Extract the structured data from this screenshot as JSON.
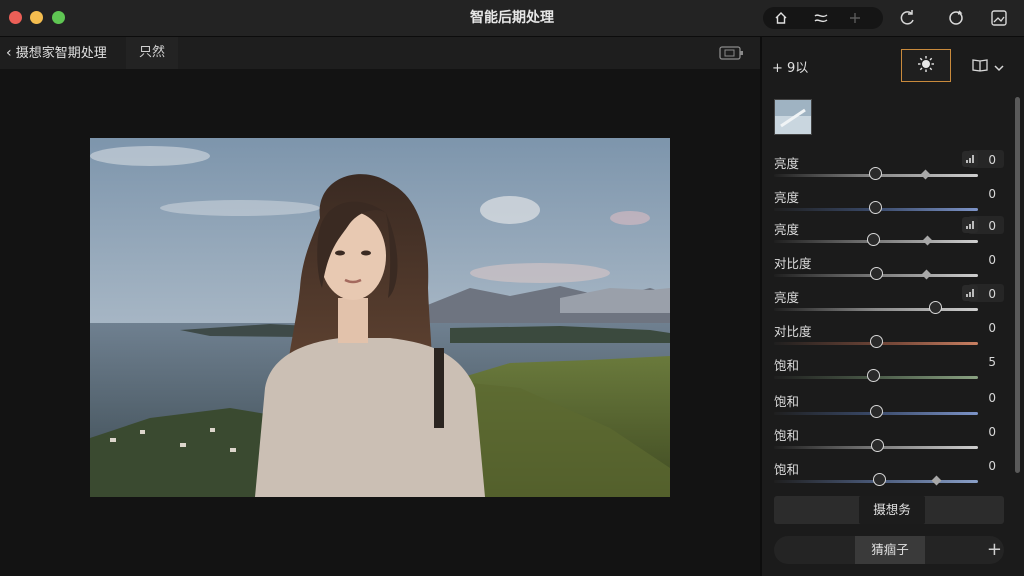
{
  "window": {
    "title": "智能后期处理",
    "icons": [
      "home-icon",
      "compare-icon",
      "sparkle-icon",
      "rotate-left-icon",
      "refresh-icon",
      "image-export-icon"
    ]
  },
  "toolbar": {
    "back_label": "摄想家智期处理",
    "tab_label": "只然"
  },
  "panel": {
    "add_label": "+ 9以",
    "adjustments": [
      {
        "label": "亮度",
        "value": "0",
        "chip": true
      },
      {
        "label": "亮度",
        "value": "0",
        "chip": false
      },
      {
        "label": "亮度",
        "value": "0",
        "chip": true
      },
      {
        "label": "对比度",
        "value": "0",
        "chip": false
      },
      {
        "label": "亮度",
        "value": "0",
        "chip": true
      },
      {
        "label": "对比度",
        "value": "0",
        "chip": false
      },
      {
        "label": "饱和",
        "value": "5",
        "chip": false
      },
      {
        "label": "饱和",
        "value": "0",
        "chip": false
      },
      {
        "label": "饱和",
        "value": "0",
        "chip": false
      },
      {
        "label": "饱和",
        "value": "0",
        "chip": false
      }
    ],
    "button1_label": "摄想务",
    "button2_label": "猜痼子"
  },
  "colors": {
    "accent": "#c98a3c",
    "panel_bg": "#1b1b1b",
    "titlebar_bg": "#232323"
  }
}
